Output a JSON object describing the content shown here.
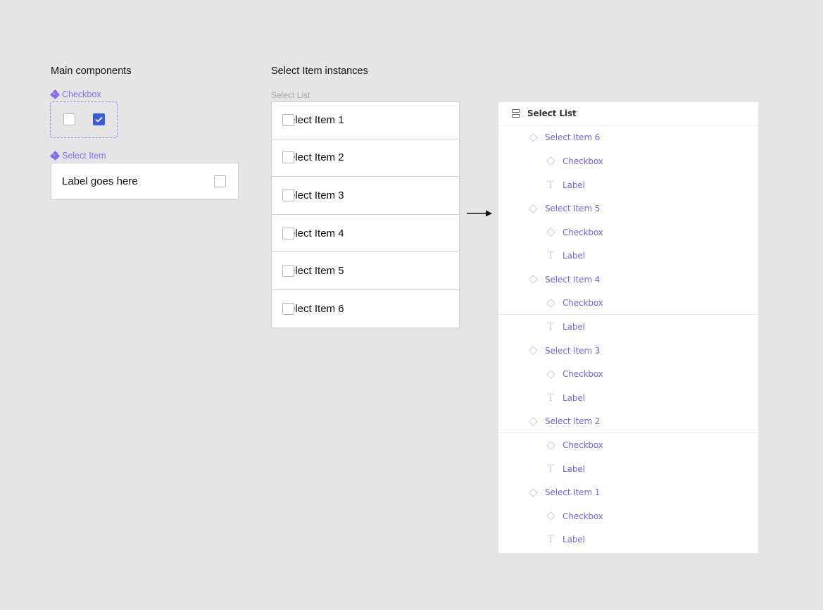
{
  "main_components": {
    "title": "Main components",
    "checkbox_component_label": "Checkbox",
    "checkbox_variants": [
      {
        "state": "unchecked"
      },
      {
        "state": "checked"
      }
    ],
    "select_item_component_label": "Select Item",
    "select_item_label": "Label goes here",
    "select_item_checked": false
  },
  "instances": {
    "title": "Select Item instances",
    "list_caption": "Select List",
    "items": [
      {
        "label": "Select Item 1",
        "checked": false
      },
      {
        "label": "Select Item 2",
        "checked": false
      },
      {
        "label": "Select Item 3",
        "checked": false
      },
      {
        "label": "Select Item 4",
        "checked": false
      },
      {
        "label": "Select Item 5",
        "checked": false
      },
      {
        "label": "Select Item 6",
        "checked": false
      }
    ]
  },
  "arrow_icon": "right-arrow-icon",
  "layers_panel": {
    "root": {
      "label": "Select List",
      "icon": "vertical-stack-icon"
    },
    "children": [
      {
        "label": "Select Item 6",
        "icon": "instance-diamond-icon",
        "children": [
          {
            "label": "Checkbox",
            "icon": "instance-diamond-icon"
          },
          {
            "label": "Label",
            "icon": "text-icon"
          }
        ]
      },
      {
        "label": "Select Item 5",
        "icon": "instance-diamond-icon",
        "children": [
          {
            "label": "Checkbox",
            "icon": "instance-diamond-icon"
          },
          {
            "label": "Label",
            "icon": "text-icon"
          }
        ]
      },
      {
        "label": "Select Item 4",
        "icon": "instance-diamond-icon",
        "children": [
          {
            "label": "Checkbox",
            "icon": "instance-diamond-icon"
          },
          {
            "label": "Label",
            "icon": "text-icon"
          }
        ]
      },
      {
        "label": "Select Item 3",
        "icon": "instance-diamond-icon",
        "children": [
          {
            "label": "Checkbox",
            "icon": "instance-diamond-icon"
          },
          {
            "label": "Label",
            "icon": "text-icon"
          }
        ]
      },
      {
        "label": "Select Item 2",
        "icon": "instance-diamond-icon",
        "children": [
          {
            "label": "Checkbox",
            "icon": "instance-diamond-icon"
          },
          {
            "label": "Label",
            "icon": "text-icon"
          }
        ]
      },
      {
        "label": "Select Item 1",
        "icon": "instance-diamond-icon",
        "children": [
          {
            "label": "Checkbox",
            "icon": "instance-diamond-icon"
          },
          {
            "label": "Label",
            "icon": "text-icon"
          }
        ]
      }
    ]
  },
  "colors": {
    "component_purple": "#8a6bf0",
    "checkbox_checked": "#3b5bdb",
    "layer_text": "#7c5fe0",
    "canvas_bg": "#e5e5e5"
  }
}
